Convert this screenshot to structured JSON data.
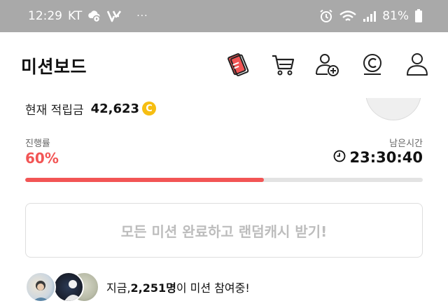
{
  "status_bar": {
    "time": "12:29",
    "carrier": "KT",
    "more": "···",
    "battery": "81%",
    "icons": [
      "weather-icon",
      "v3-logo-icon",
      "alarm-icon",
      "wifi-icon",
      "signal-icon",
      "battery-icon"
    ]
  },
  "header": {
    "title": "미션보드",
    "icons": [
      "mission-card-icon",
      "cart-icon",
      "add-friend-icon",
      "coin-icon",
      "profile-icon"
    ]
  },
  "points": {
    "label": "현재 적립금",
    "value": "42,623",
    "coin_symbol": "C"
  },
  "progress": {
    "label": "진행률",
    "percent_text": "60%",
    "fraction": 0.6,
    "time_label": "남은시간",
    "time_left": "23:30:40"
  },
  "complete_button": {
    "label": "모든 미션 완료하고 랜덤캐시 받기!"
  },
  "participants": {
    "prefix": "지금, ",
    "count": "2,251명",
    "suffix": "이 미션 참여중!"
  },
  "colors": {
    "accent": "#f25555",
    "coin": "#f6be12",
    "status_bar": "#a9a9a9",
    "button_text_disabled": "#bdbdbd"
  }
}
